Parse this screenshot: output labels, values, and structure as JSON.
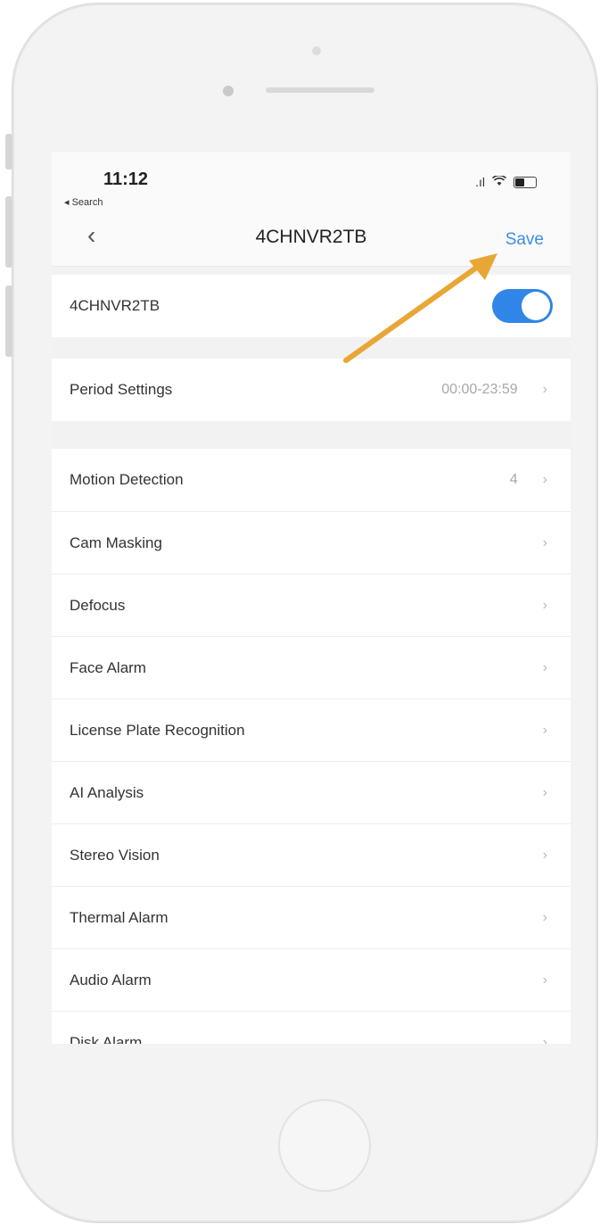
{
  "status_bar": {
    "time": "11:12",
    "back_app": "◂ Search"
  },
  "nav": {
    "title": "4CHNVR2TB",
    "save_label": "Save",
    "back_icon": "chevron-left-icon"
  },
  "device_toggle": {
    "label": "4CHNVR2TB",
    "enabled": true
  },
  "period": {
    "label": "Period Settings",
    "value": "00:00-23:59"
  },
  "settings": [
    {
      "label": "Motion Detection",
      "value": "4"
    },
    {
      "label": "Cam Masking",
      "value": ""
    },
    {
      "label": "Defocus",
      "value": ""
    },
    {
      "label": "Face Alarm",
      "value": ""
    },
    {
      "label": "License Plate Recognition",
      "value": ""
    },
    {
      "label": "AI Analysis",
      "value": ""
    },
    {
      "label": "Stereo Vision",
      "value": ""
    },
    {
      "label": "Thermal Alarm",
      "value": ""
    },
    {
      "label": "Audio Alarm",
      "value": ""
    },
    {
      "label": "Disk Alarm",
      "value": ""
    }
  ],
  "colors": {
    "accent": "#2f86e8",
    "annotation_arrow": "#e8a735"
  }
}
